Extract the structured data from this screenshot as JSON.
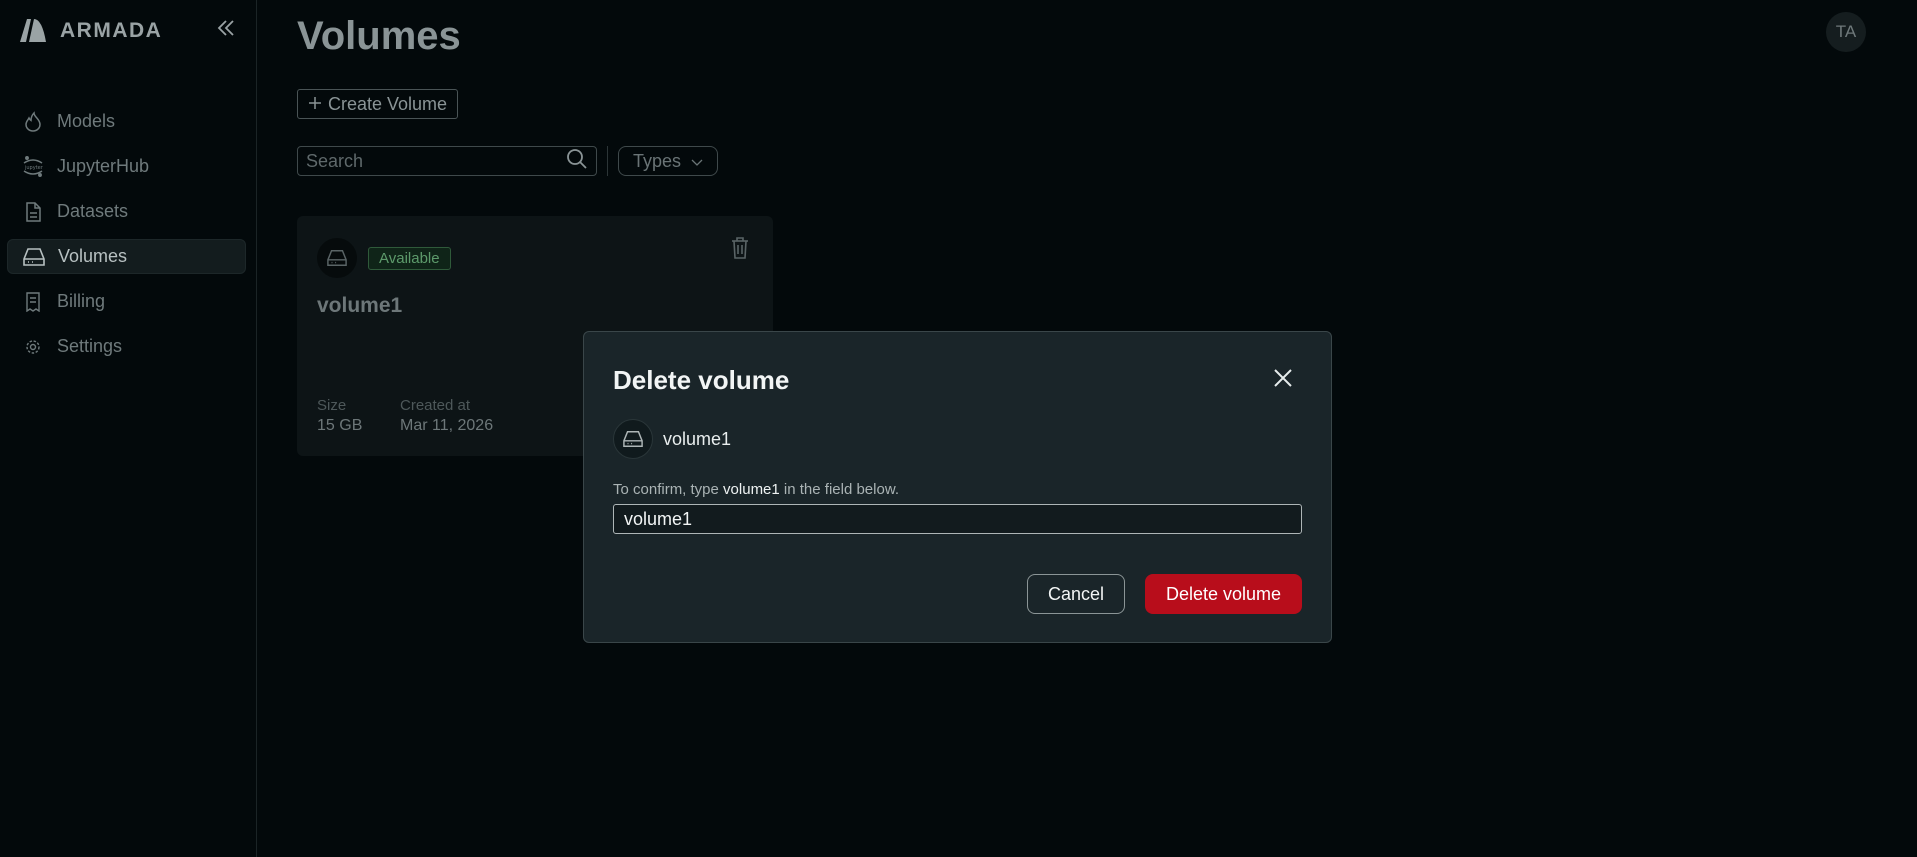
{
  "brand": {
    "name": "ARMADA",
    "logo_icon": "armada-logo-icon"
  },
  "sidebar": {
    "collapse_icon": "chevrons-left-icon",
    "items": [
      {
        "label": "Models",
        "icon": "flame-icon",
        "active": false
      },
      {
        "label": "JupyterHub",
        "icon": "jupyter-icon",
        "active": false
      },
      {
        "label": "Datasets",
        "icon": "file-icon",
        "active": false
      },
      {
        "label": "Volumes",
        "icon": "drive-icon",
        "active": true
      },
      {
        "label": "Billing",
        "icon": "receipt-icon",
        "active": false
      },
      {
        "label": "Settings",
        "icon": "gear-icon",
        "active": false
      }
    ]
  },
  "header": {
    "title": "Volumes",
    "avatar_initials": "TA"
  },
  "toolbar": {
    "create_label": "Create Volume",
    "search_placeholder": "Search",
    "types_label": "Types"
  },
  "volume_card": {
    "status": "Available",
    "name": "volume1",
    "size_label": "Size",
    "size_value": "15 GB",
    "created_label": "Created at",
    "created_value": "Mar 11, 2026"
  },
  "modal": {
    "title": "Delete volume",
    "volume_name": "volume1",
    "confirm_prefix": "To confirm, type ",
    "confirm_target": "volume1",
    "confirm_suffix": " in the field below.",
    "input_value": "volume1",
    "cancel_label": "Cancel",
    "delete_label": "Delete volume"
  },
  "colors": {
    "background": "#03090b",
    "modal_bg": "#1a2529",
    "danger": "#b80d1b",
    "badge_green": "#5d9a6b"
  }
}
